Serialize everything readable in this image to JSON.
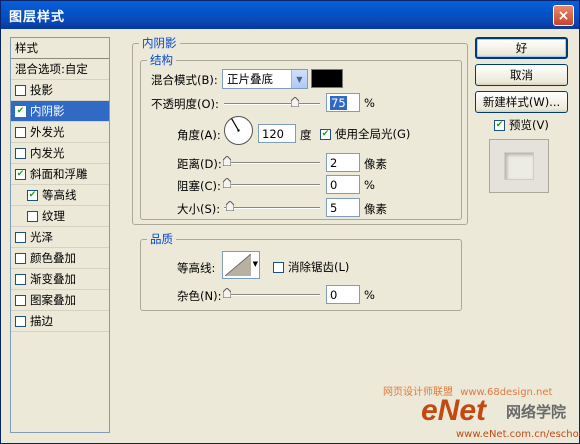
{
  "window": {
    "title": "图层样式",
    "close_glyph": "×"
  },
  "style_list": {
    "header": "样式",
    "items": [
      {
        "label": "混合选项:自定",
        "checkbox": false,
        "checked": false,
        "selected": false,
        "indent": false
      },
      {
        "label": "投影",
        "checkbox": true,
        "checked": false,
        "selected": false,
        "indent": false
      },
      {
        "label": "内阴影",
        "checkbox": true,
        "checked": true,
        "selected": true,
        "indent": false
      },
      {
        "label": "外发光",
        "checkbox": true,
        "checked": false,
        "selected": false,
        "indent": false
      },
      {
        "label": "内发光",
        "checkbox": true,
        "checked": false,
        "selected": false,
        "indent": false
      },
      {
        "label": "斜面和浮雕",
        "checkbox": true,
        "checked": true,
        "selected": false,
        "indent": false
      },
      {
        "label": "等高线",
        "checkbox": true,
        "checked": true,
        "selected": false,
        "indent": true
      },
      {
        "label": "纹理",
        "checkbox": true,
        "checked": false,
        "selected": false,
        "indent": true
      },
      {
        "label": "光泽",
        "checkbox": true,
        "checked": false,
        "selected": false,
        "indent": false
      },
      {
        "label": "颜色叠加",
        "checkbox": true,
        "checked": false,
        "selected": false,
        "indent": false
      },
      {
        "label": "渐变叠加",
        "checkbox": true,
        "checked": false,
        "selected": false,
        "indent": false
      },
      {
        "label": "图案叠加",
        "checkbox": true,
        "checked": false,
        "selected": false,
        "indent": false
      },
      {
        "label": "描边",
        "checkbox": true,
        "checked": false,
        "selected": false,
        "indent": false
      }
    ]
  },
  "panel": {
    "title": "内阴影",
    "structure": {
      "title": "结构",
      "blend_mode_label": "混合模式(B):",
      "blend_mode_value": "正片叠底",
      "blend_color": "#000000",
      "opacity_label": "不透明度(O):",
      "opacity_value": "75",
      "opacity_unit": "%",
      "angle_label": "角度(A):",
      "angle_value": "120",
      "angle_unit": "度",
      "global_light_label": "使用全局光(G)",
      "global_light_checked": true,
      "distance_label": "距离(D):",
      "distance_value": "2",
      "distance_unit": "像素",
      "choke_label": "阻塞(C):",
      "choke_value": "0",
      "choke_unit": "%",
      "size_label": "大小(S):",
      "size_value": "5",
      "size_unit": "像素"
    },
    "quality": {
      "title": "品质",
      "contour_label": "等高线:",
      "antialias_label": "消除锯齿(L)",
      "antialias_checked": false,
      "noise_label": "杂色(N):",
      "noise_value": "0",
      "noise_unit": "%"
    }
  },
  "buttons": {
    "ok": "好",
    "cancel": "取消",
    "new_style": "新建样式(W)...",
    "preview_label": "预览(V)",
    "preview_checked": true
  },
  "watermark": {
    "line1": "网页设计师联盟",
    "line2": "www.68design.net",
    "brand": "eNet",
    "brand_cn": "网络学院",
    "url": "www.eNet.com.cn/eschool"
  }
}
